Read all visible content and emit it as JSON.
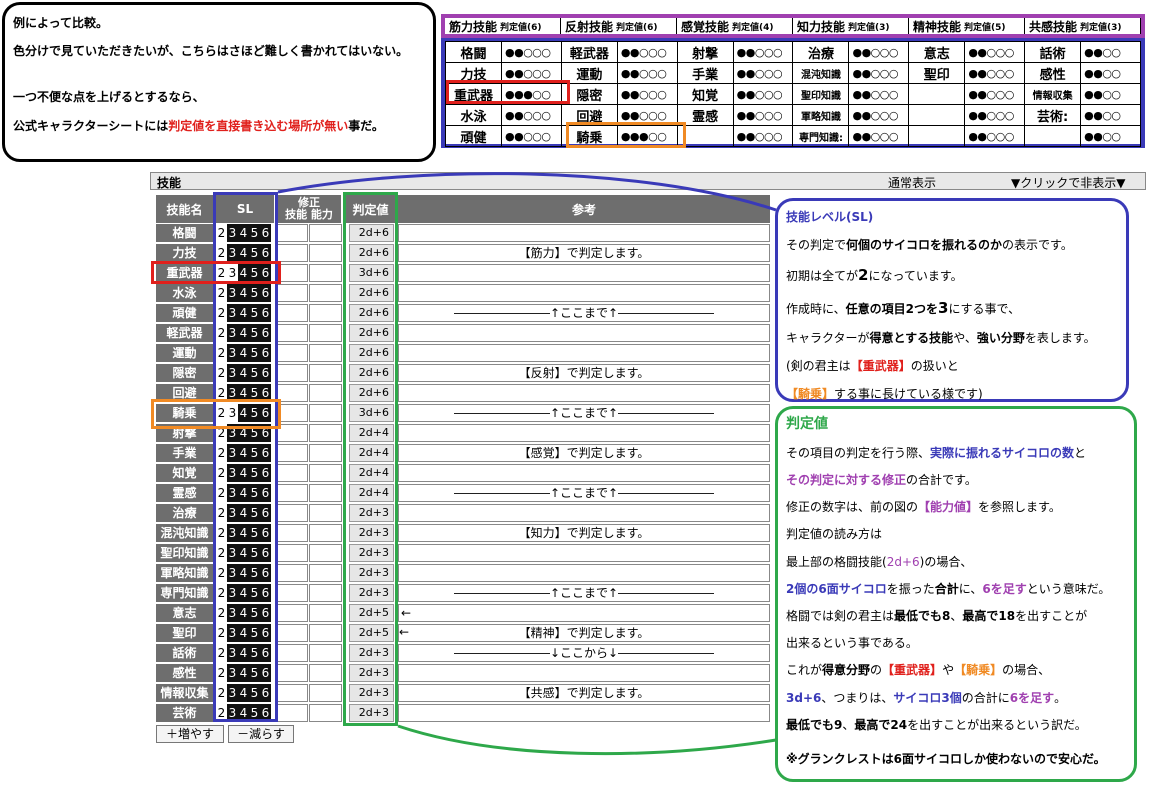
{
  "note": {
    "line1": "例によって比較。",
    "line2": "色分けで見ていただきたいが、こちらはさほど難しく書かれてはいない。",
    "line3": "一つ不便な点を上げるとするなら、",
    "line4_a": "公式キャラクターシートには",
    "line4_b": "判定値を直接書き込む場所が無い",
    "line4_c": "事だ。"
  },
  "sheet": {
    "header": [
      {
        "name": "筋力技能",
        "label": "判定値(6)"
      },
      {
        "name": "反射技能",
        "label": "判定値(6)"
      },
      {
        "name": "感覚技能",
        "label": "判定値(4)"
      },
      {
        "name": "知力技能",
        "label": "判定値(3)"
      },
      {
        "name": "精神技能",
        "label": "判定値(5)"
      },
      {
        "name": "共感技能",
        "label": "判定値(3)"
      }
    ],
    "rows": [
      [
        "格闘",
        "●●○○○",
        "軽武器",
        "●●○○○",
        "射撃",
        "●●○○○",
        "治療",
        "●●○○○",
        "意志",
        "●●○○○",
        "話術",
        "●●○○"
      ],
      [
        "力技",
        "●●○○○",
        "運動",
        "●●○○○",
        "手業",
        "●●○○○",
        "混沌知識",
        "●●○○○",
        "聖印",
        "●●○○○",
        "感性",
        "●●○○"
      ],
      [
        "重武器",
        "●●●○○",
        "隠密",
        "●●○○○",
        "知覚",
        "●●○○○",
        "聖印知識",
        "●●○○○",
        "",
        "●●○○○",
        "情報収集",
        "●●○○"
      ],
      [
        "水泳",
        "●●○○○",
        "回避",
        "●●○○○",
        "霊感",
        "●●○○○",
        "軍略知識",
        "●●○○○",
        "",
        "●●○○○",
        "芸術:",
        "●●○○"
      ],
      [
        "頑健",
        "●●○○○",
        "騎乗",
        "●●●○○",
        "",
        "●●○○○",
        "専門知識:",
        "●●○○○",
        "",
        "●●○○○",
        "",
        "●●○○"
      ]
    ]
  },
  "panel": {
    "title": "技能",
    "mode": "通常表示",
    "toggle": "▼クリックで非表示▼",
    "col_name": "技能名",
    "col_sl": "SL",
    "col_mod_top": "修正",
    "col_mod_skill": "技能",
    "col_mod_ability": "能力",
    "col_value": "判定値",
    "col_ref": "参考",
    "add_button": "＋増やす",
    "remove_button": "－減らす"
  },
  "skills": [
    {
      "name": "格闘",
      "sl": 2,
      "value": "2d+6",
      "ref": ""
    },
    {
      "name": "力技",
      "sl": 2,
      "value": "2d+6",
      "ref": "【筋力】で判定します。"
    },
    {
      "name": "重武器",
      "sl": 3,
      "value": "3d+6",
      "ref": ""
    },
    {
      "name": "水泳",
      "sl": 2,
      "value": "2d+6",
      "ref": ""
    },
    {
      "name": "頑健",
      "sl": 2,
      "value": "2d+6",
      "ref": "――――――――↑ここまで↑――――――――"
    },
    {
      "name": "軽武器",
      "sl": 2,
      "value": "2d+6",
      "ref": ""
    },
    {
      "name": "運動",
      "sl": 2,
      "value": "2d+6",
      "ref": ""
    },
    {
      "name": "隠密",
      "sl": 2,
      "value": "2d+6",
      "ref": "【反射】で判定します。"
    },
    {
      "name": "回避",
      "sl": 2,
      "value": "2d+6",
      "ref": ""
    },
    {
      "name": "騎乗",
      "sl": 3,
      "value": "3d+6",
      "ref": "――――――――↑ここまで↑――――――――"
    },
    {
      "name": "射撃",
      "sl": 2,
      "value": "2d+4",
      "ref": ""
    },
    {
      "name": "手業",
      "sl": 2,
      "value": "2d+4",
      "ref": "【感覚】で判定します。"
    },
    {
      "name": "知覚",
      "sl": 2,
      "value": "2d+4",
      "ref": ""
    },
    {
      "name": "霊感",
      "sl": 2,
      "value": "2d+4",
      "ref": "――――――――↑ここまで↑――――――――"
    },
    {
      "name": "治療",
      "sl": 2,
      "value": "2d+3",
      "ref": ""
    },
    {
      "name": "混沌知識",
      "sl": 2,
      "value": "2d+3",
      "ref": "【知力】で判定します。"
    },
    {
      "name": "聖印知識",
      "sl": 2,
      "value": "2d+3",
      "ref": ""
    },
    {
      "name": "軍略知識",
      "sl": 2,
      "value": "2d+3",
      "ref": ""
    },
    {
      "name": "専門知識",
      "sl": 2,
      "value": "2d+3",
      "ref": "――――――――↑ここまで↑――――――――"
    },
    {
      "name": "意志",
      "sl": 2,
      "value": "2d+5",
      "ref": "←",
      "arrow": true
    },
    {
      "name": "聖印",
      "sl": 2,
      "value": "2d+5",
      "ref": "【精神】で判定します。",
      "arrow_extra": "←"
    },
    {
      "name": "話術",
      "sl": 2,
      "value": "2d+3",
      "ref": "――――――――↓ここから↓――――――――"
    },
    {
      "name": "感性",
      "sl": 2,
      "value": "2d+3",
      "ref": ""
    },
    {
      "name": "情報収集",
      "sl": 2,
      "value": "2d+3",
      "ref": "【共感】で判定します。"
    },
    {
      "name": "芸術",
      "sl": 2,
      "value": "2d+3",
      "ref": ""
    }
  ],
  "explain_sl": {
    "heading": "技能レベル(SL)",
    "l1_a": "その判定で",
    "l1_b": "何個のサイコロを振れるのか",
    "l1_c": "の表示です。",
    "l2_a": "初期は全てが",
    "l2_b": "2",
    "l2_c": "になっています。",
    "l3_a": "作成時に、",
    "l3_b": "任意の項目2つを",
    "l3_c": "3",
    "l3_d": "にする事で、",
    "l4_a": "キャラクターが",
    "l4_b": "得意とする技能",
    "l4_c": "や、",
    "l4_d": "強い分野",
    "l4_e": "を表します。",
    "l5_a": "(剣の君主は",
    "l5_b": "【重武器】",
    "l5_c": "の扱いと",
    "l6_a": "【騎乗】",
    "l6_b": "する事に長けている様です)"
  },
  "explain_value": {
    "heading": "判定値",
    "l1_a": "その項目の判定を行う際、",
    "l1_b": "実際に振れるサイコロの数",
    "l1_c": "と",
    "l2_a": "その判定に対する修正",
    "l2_b": "の合計です。",
    "l3_a": "修正の数字は、前の図の",
    "l3_b": "【能力値】",
    "l3_c": "を参照します。",
    "l4": "判定値の読み方は",
    "l5_a": "最上部の格闘技能(",
    "l5_b": "2d+6",
    "l5_c": ")の場合、",
    "l6_a": "2個の6面サイコロ",
    "l6_b": "を振った",
    "l6_c": "合計",
    "l6_d": "に、",
    "l6_e": "6を足す",
    "l6_f": "という意味だ。",
    "l7_a": "格闘では剣の君主は",
    "l7_b": "最低でも8",
    "l7_c": "、",
    "l7_d": "最高で18",
    "l7_e": "を出すことが",
    "l8": "出来るという事である。",
    "l9_a": "これが",
    "l9_b": "得意分野",
    "l9_c": "の",
    "l9_d": "【重武器】",
    "l9_e": "や",
    "l9_f": "【騎乗】",
    "l9_g": "の場合、",
    "l10_a": "3d+6",
    "l10_b": "、つまりは、",
    "l10_c": "サイコロ3個",
    "l10_d": "の合計に",
    "l10_e": "6を足す",
    "l10_f": "。",
    "l11_a": "最低でも9",
    "l11_b": "、",
    "l11_c": "最高で24",
    "l11_d": "を出すことが出来るという訳だ。",
    "l12": "※グランクレストは6面サイコロしか使わないので安心だ。"
  },
  "colors": {
    "blue": "#3a3ab8",
    "green": "#2ea84a",
    "red": "#e0201c",
    "orange": "#f08a24",
    "purple": "#a040b0",
    "header_gray": "#6e6e6e"
  }
}
